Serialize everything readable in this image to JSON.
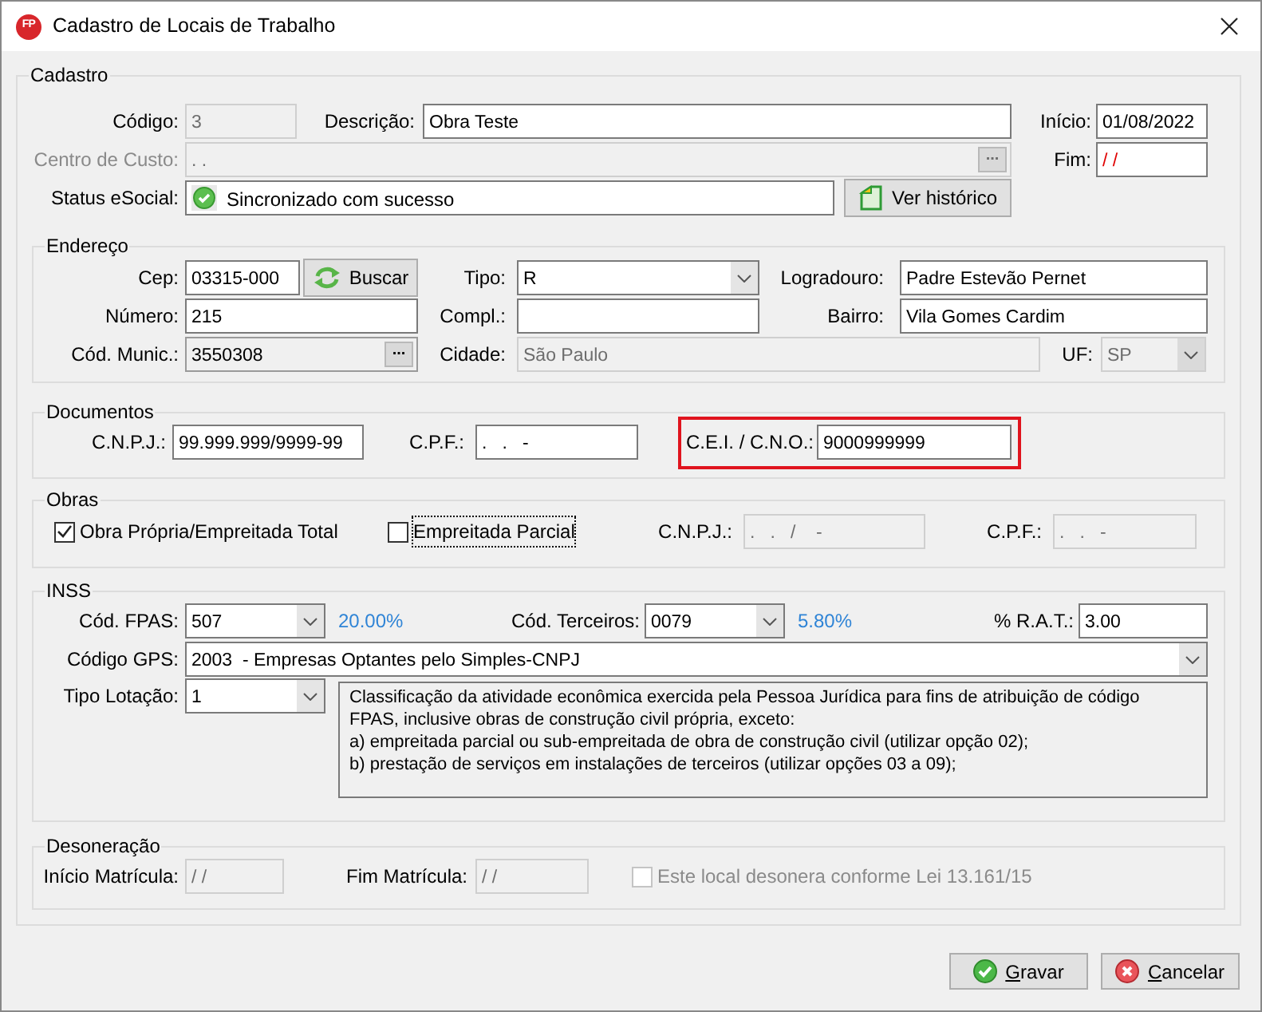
{
  "window": {
    "app_badge": "FP",
    "title": "Cadastro de Locais de Trabalho"
  },
  "form": {
    "legend": "Cadastro",
    "fields": [
      {
        "kind": "text",
        "label": "Código:",
        "value": "3",
        "disabled": true
      },
      {
        "kind": "text",
        "label": "Descrição:",
        "value": "Obra Teste"
      },
      {
        "kind": "text",
        "label": "Início:",
        "value": "01/08/2022"
      },
      {
        "kind": "lookup",
        "label": "Centro de Custo:",
        "value": ". .",
        "button": "...",
        "disabled": true,
        "label_disabled": true
      },
      {
        "kind": "text",
        "label": "Fim:",
        "value": "/ /",
        "invalid": true
      },
      {
        "kind": "status",
        "label": "Status eSocial:",
        "value": "Sincronizado com sucesso"
      },
      {
        "kind": "button",
        "text": "Ver histórico"
      }
    ],
    "groups": [
      {
        "legend": "Endereço",
        "fields": [
          {
            "kind": "text",
            "label": "Cep:",
            "value": "03315-000"
          },
          {
            "kind": "button",
            "text": "Buscar"
          },
          {
            "kind": "combo",
            "label": "Tipo:",
            "value": "R"
          },
          {
            "kind": "text",
            "label": "Logradouro:",
            "value": "Padre Estevão Pernet"
          },
          {
            "kind": "text",
            "label": "Número:",
            "value": "215"
          },
          {
            "kind": "text",
            "label": "Compl.:"
          },
          {
            "kind": "text",
            "label": "Bairro:",
            "value": "Vila Gomes Cardim"
          },
          {
            "kind": "lookup",
            "label": "Cód. Munic.:",
            "value": "3550308",
            "button": "...",
            "readonly": true
          },
          {
            "kind": "text",
            "label": "Cidade:",
            "value": "São Paulo",
            "disabled": true
          },
          {
            "kind": "combo",
            "label": "UF:",
            "value": "SP",
            "disabled": true
          }
        ]
      },
      {
        "legend": "Documentos",
        "fields": [
          {
            "kind": "text",
            "label": "C.N.P.J.:",
            "value": "99.999.999/9999-99"
          },
          {
            "kind": "text",
            "label": "C.P.F.:",
            "value": ".   .   -"
          },
          {
            "kind": "text",
            "label": "C.E.I. / C.N.O.:",
            "value": "9000999999",
            "highlighted": true
          }
        ]
      },
      {
        "legend": "Obras",
        "fields": [
          {
            "kind": "checkbox",
            "text": "Obra Própria/Empreitada Total",
            "checked": true,
            "focused": false,
            "disabled": false
          },
          {
            "kind": "checkbox",
            "text": "Empreitada Parcial",
            "checked": false,
            "focused": true,
            "disabled": false
          },
          {
            "kind": "text",
            "label": "C.N.P.J.:",
            "value": ".   .   /    -",
            "disabled": true
          },
          {
            "kind": "text",
            "label": "C.P.F.:",
            "value": ".   .   -",
            "disabled": true
          }
        ]
      },
      {
        "legend": "INSS",
        "fields": [
          {
            "kind": "combo",
            "label": "Cód. FPAS:",
            "value": "507"
          },
          {
            "kind": "note",
            "text": "20.00%"
          },
          {
            "kind": "combo",
            "label": "Cód. Terceiros:",
            "value": "0079"
          },
          {
            "kind": "note",
            "text": "5.80%"
          },
          {
            "kind": "text",
            "label": "% R.A.T.:",
            "value": "3.00"
          },
          {
            "kind": "combo",
            "label": "Código GPS:",
            "value": "2003  - Empresas Optantes pelo Simples-CNPJ"
          },
          {
            "kind": "combo",
            "label": "Tipo Lotação:",
            "value": "1"
          },
          {
            "kind": "memo",
            "lines": [
              "Classificação da atividade econômica exercida pela Pessoa Jurídica para fins de atribuição de código",
              "FPAS, inclusive obras de construção civil própria, exceto:",
              "a) empreitada parcial ou sub-empreitada de obra de construção civil (utilizar opção 02);",
              "b) prestação de serviços em instalações de terceiros (utilizar opções 03 a 09);"
            ]
          }
        ]
      },
      {
        "legend": "Desoneração",
        "fields": [
          {
            "kind": "text",
            "label": "Início Matrícula:",
            "value": "/ /",
            "disabled": true
          },
          {
            "kind": "text",
            "label": "Fim Matrícula:",
            "value": "/ /",
            "disabled": true
          },
          {
            "kind": "checkbox",
            "text": "Este local desonera conforme Lei 13.161/15",
            "checked": false,
            "focused": false,
            "disabled": true
          }
        ]
      }
    ]
  },
  "buttons": [
    {
      "text": "Gravar",
      "underline_first": true
    },
    {
      "text": "Cancelar",
      "underline_first": true
    }
  ]
}
